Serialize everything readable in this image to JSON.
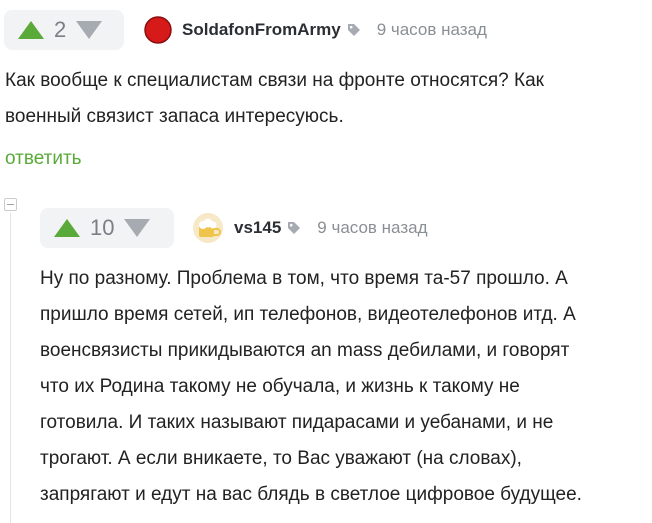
{
  "comment1": {
    "rating": "2",
    "username": "SoldafonFromArmy",
    "time": "9 часов назад",
    "lines": [
      "Как вообще к специалистам связи на фронте относятся? Как",
      "военный связист запаса интересуюсь."
    ],
    "reply_label": "ответить"
  },
  "comment2": {
    "rating": "10",
    "username": "vs145",
    "time": "9 часов назад",
    "lines": [
      "Ну по разному. Проблема в том, что время та-57 прошло. А",
      "пришло время сетей, ип телефонов, видеотелефонов итд. А",
      "военсвязисты прикидываются an mass дебилами, и говорят",
      "что их Родина такому не обучала, и жизнь к такому не",
      "готовила. И таких называют пидарасами и уебанами, и не",
      "трогают. А если вникаете, то Вас уважают (на словах),",
      "запрягают и едут на вас блядь в светлое цифровое будущее."
    ]
  },
  "colors": {
    "upvote": "#5aaa3a",
    "downvote": "#a6abb1",
    "reply": "#5aaa3a",
    "avatar1": "#d61a1a"
  }
}
